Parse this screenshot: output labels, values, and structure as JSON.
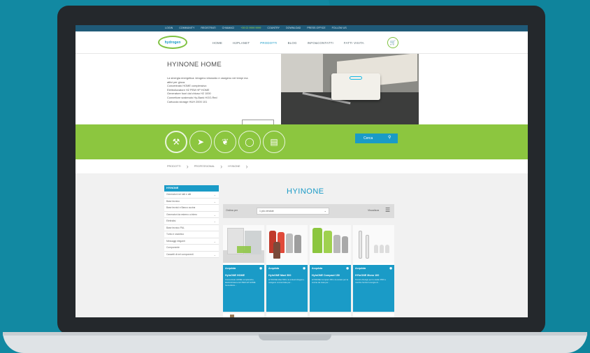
{
  "topbar": {
    "items": [
      "LOGIN",
      "COMMUNITY",
      "REGISTRATI",
      "CHIAMACI",
      "+39 02 9999 9999",
      "COUNTRY",
      "DOWNLOAD",
      "PRESS OFFICE",
      "FOLLOW US"
    ]
  },
  "header": {
    "logo_text": "hydrogen",
    "nav": [
      "HOME",
      "H2PLANET",
      "PRODOTTI",
      "BLOG",
      "INFO&CONTATTI",
      "FATTI VISITA"
    ],
    "active_nav": "PRODOTTI",
    "cart_icon": "cart-icon"
  },
  "hero": {
    "title": "HYINONE HOME",
    "desc": [
      "La sinergia energetica: idrogeno idrossido e ossigeno nei tempi ma",
      "attivi per gioca.",
      "Concentrato HOME complessivo",
      "Elettrolizzatore H2 PEM HP HOME",
      "Generatore fuori dal chiuso H2 1000",
      "Connettore sostenuto Hy-Bank HOO-Red",
      "Cartuccia storage HUH 2000 101"
    ]
  },
  "categories": {
    "icons": [
      "tools-icon",
      "rocket-icon",
      "leaf-icon",
      "lightbulb-icon",
      "book-icon"
    ],
    "search_label": "Cerca"
  },
  "breadcrumb": [
    "PRODOTTI",
    "PROFESSIONAL",
    "HYINONE"
  ],
  "sidebar": {
    "heading": "HYINONE",
    "items": [
      {
        "label": "Generatori nei tutti e atti",
        "chevron": true
      },
      {
        "label": "Base tecnico",
        "chevron": true
      },
      {
        "label": "Base tecnici e Banco cucina",
        "chevron": false
      },
      {
        "label": "Generatori da esterno a intero",
        "chevron": true
      },
      {
        "label": "Elettrolisi",
        "chevron": true
      },
      {
        "label": "Base tecnico PAL",
        "chevron": false
      },
      {
        "label": "Turbo e ossidrico",
        "chevron": false
      },
      {
        "label": "Messaggi eleganti",
        "chevron": true
      },
      {
        "label": "Componente",
        "chevron": false
      },
      {
        "label": "Cassetti di nel componenti",
        "chevron": true
      }
    ]
  },
  "main": {
    "title": "HYINONE",
    "filter_label": "Ordina per",
    "filter_value": "1 più venduti",
    "view_label": "Visualizza",
    "menu_icon": "list-view-icon"
  },
  "products": [
    {
      "badge": "Acquista",
      "name": "HyInONE HOME",
      "desc": "Concentrato HOME complessivo, Elettrolizzatore H2 PEM HP HOME Generatore..."
    },
    {
      "badge": "Acquista",
      "name": "HyInONE Maxi 500",
      "desc": "HYINONE Maxi 500 è la sintesi idrogeno-ossigeno concentrata per..."
    },
    {
      "badge": "Acquista",
      "name": "HyInONE Compact 150",
      "desc": "HYINONE Compact 150 è la sintesi per la cucina da casa per..."
    },
    {
      "badge": "Acquista",
      "name": "HYinONE Mono 100",
      "desc": "Tecnico Design per lo studio PRO e marche fornitori energia di..."
    }
  ]
}
